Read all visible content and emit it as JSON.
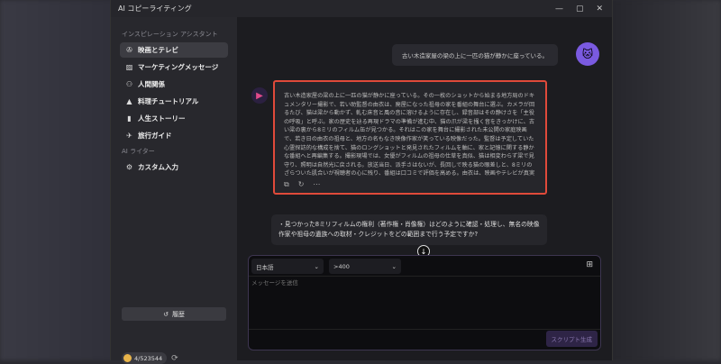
{
  "window": {
    "title": "AI コピーライティング"
  },
  "sidebar": {
    "section1": "インスピレーション アシスタント",
    "items": [
      {
        "label": "映画とテレビ",
        "icon": "film-reel-icon"
      },
      {
        "label": "マーケティングメッセージ",
        "icon": "chart-icon"
      },
      {
        "label": "人間関係",
        "icon": "people-icon"
      },
      {
        "label": "料理チュートリアル",
        "icon": "cooking-icon"
      },
      {
        "label": "人生ストーリー",
        "icon": "book-icon"
      },
      {
        "label": "旅行ガイド",
        "icon": "airplane-icon"
      }
    ],
    "section2": "AI ライター",
    "custom": {
      "label": "カスタム入力",
      "icon": "gear-icon"
    },
    "history_label": "履歴",
    "credits": "4/523544"
  },
  "chat": {
    "user_message": "古い木造家屋の梁の上に一匹の猫が静かに座っている。",
    "assistant_message": "古い木造家屋の梁の上に一匹の猫が静かに座っている。その一枚のショットから始まる地方局のドキュメンタリー撮影で、若い助監督の由衣は、廃屋になった祖母の家を番組の舞台に選ぶ。カメラが回るたび、猫は梁から動かず、軋む床音と風の音に溶けるように存在し、録音部はその静けさを「主役の呼吸」と呼ぶ。家の歴史を辿る再現ドラマの準備が進む中、猫の爪が梁を掻く音をきっかけに、古い梁の裏から8ミリのフィルム缶が見つかる。それはこの家を舞台に撮影された未公開の家庭映画で、若き日の由衣の祖母と、地方の名もなき映像作家が笑っている映像だった。監督は予定していた心霊探訪的な構成を捨て、猫のロングショットと発見されたフィルムを軸に、家と記憶に関する静かな番組へと再編集する。撮影現場では、女優がフィルムの祖母の仕草を真似、猫は相変わらず梁で見守り、照明は自然光に戻される。放送当日、派手さはないが、長回しで映る猫の眼差しと、8ミリのざらついた肌合いが視聴者の心に残り、番組は口コミで評価を高める。由衣は、映画やテレビが真実を暴くのではなく、残された静けさに耳を澄ます方法を選べることを学び、猫はその象徴として、最後のカットでゆっくりと梁から立ち上がる。",
    "followup": "・見つかった8ミリフィルムの権利（著作権・肖像権）はどのように確認・処理し、無名の映像作家や祖母の遺族への取材・クレジットをどの範囲まで行う予定ですか?"
  },
  "composer": {
    "language": "日本語",
    "length": ">400",
    "placeholder": "メッセージを送信",
    "generate_label": "スクリプト生成"
  }
}
